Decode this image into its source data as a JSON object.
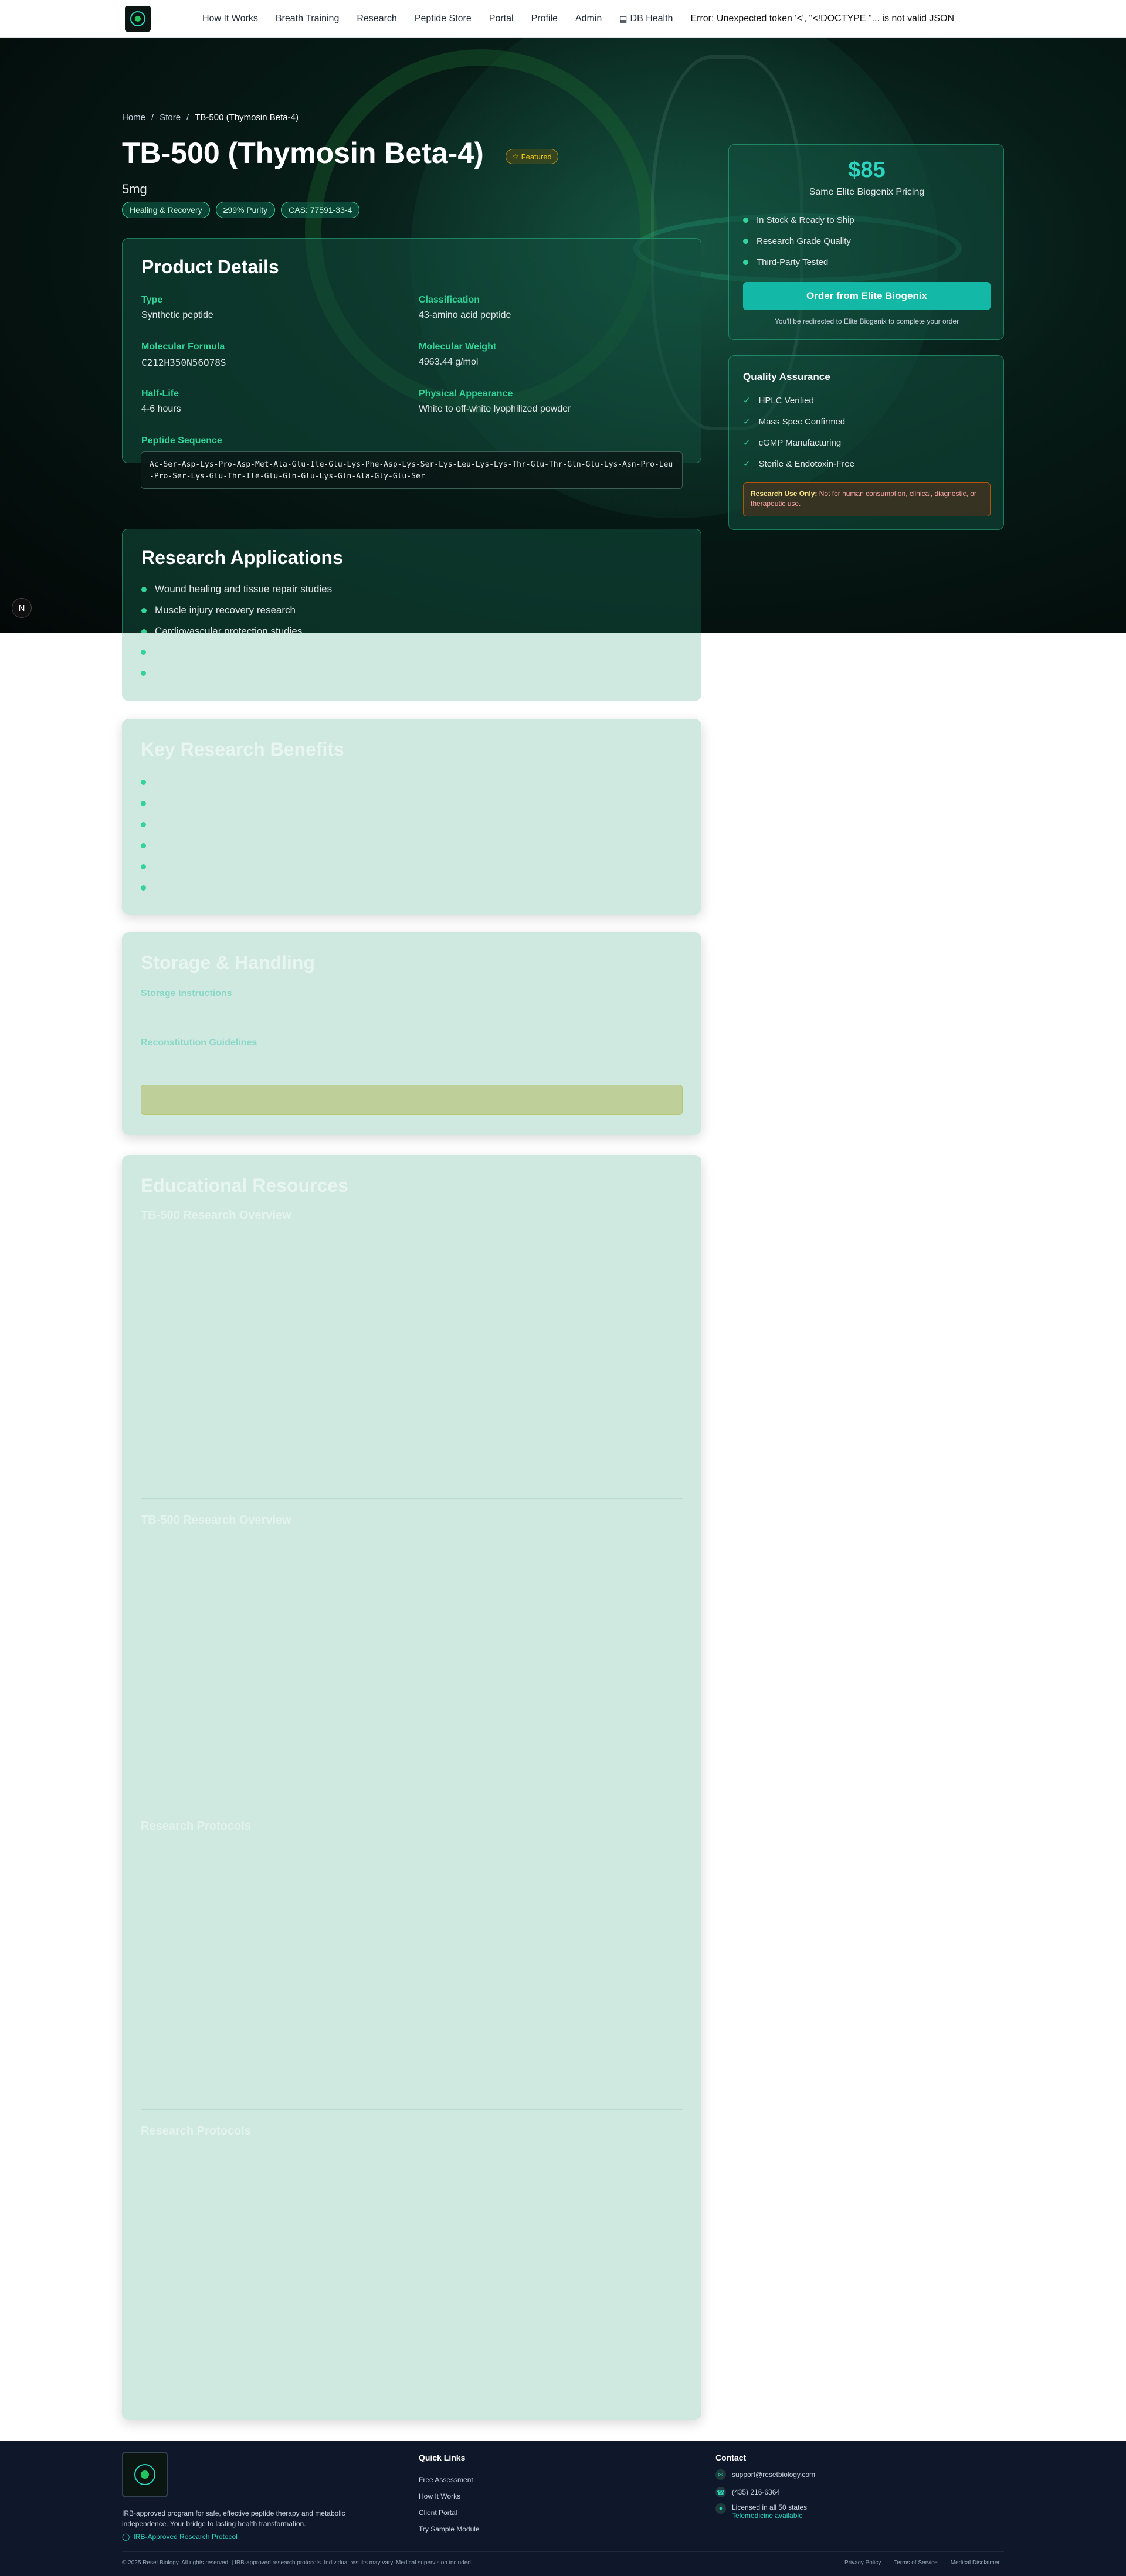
{
  "nav": {
    "links": [
      "How It Works",
      "Breath Training",
      "Research",
      "Peptide Store",
      "Portal",
      "Profile",
      "Admin",
      "DB Health"
    ],
    "db_icon": "database-icon",
    "error": "Error: Unexpected token '<', \"<!DOCTYPE \"... is not valid JSON"
  },
  "breadcrumb": [
    "Home",
    "Store",
    "TB-500 (Thymosin Beta-4)"
  ],
  "product": {
    "title": "TB-500 (Thymosin Beta-4)",
    "featured": "Featured",
    "size": "5mg",
    "tags": [
      "Healing & Recovery",
      "≥99% Purity",
      "CAS: 77591-33-4"
    ]
  },
  "details": {
    "heading": "Product Details",
    "fields": [
      {
        "label": "Type",
        "value": "Synthetic peptide"
      },
      {
        "label": "Classification",
        "value": "43-amino acid peptide"
      },
      {
        "label": "Molecular Formula",
        "value": "C212H350N56O78S"
      },
      {
        "label": "Molecular Weight",
        "value": "4963.44 g/mol"
      },
      {
        "label": "Half-Life",
        "value": "4-6 hours"
      },
      {
        "label": "Physical Appearance",
        "value": "White to off-white lyophilized powder"
      }
    ],
    "sequence_label": "Peptide Sequence",
    "sequence": "Ac-Ser-Asp-Lys-Pro-Asp-Met-Ala-Glu-Ile-Glu-Lys-Phe-Asp-Lys-Ser-Lys-Leu-Lys-Lys-Thr-Glu-Thr-Gln-Glu-Lys-Asn-Pro-Leu-Pro-Ser-Lys-Glu-Thr-Ile-Glu-Gln-Glu-Lys-Gln-Ala-Gly-Glu-Ser"
  },
  "applications": {
    "heading": "Research Applications",
    "items": [
      "Wound healing and tissue repair studies",
      "Muscle injury recovery research",
      "Cardiovascular protection studies"
    ]
  },
  "pricing": {
    "price": "$85",
    "subtitle": "Same Elite Biogenix Pricing",
    "features": [
      "In Stock & Ready to Ship",
      "Research Grade Quality",
      "Third-Party Tested"
    ],
    "button": "Order from Elite Biogenix",
    "note": "You'll be redirected to Elite Biogenix to complete your order"
  },
  "quality": {
    "heading": "Quality Assurance",
    "items": [
      "HPLC Verified",
      "Mass Spec Confirmed",
      "cGMP Manufacturing",
      "Sterile & Endotoxin-Free"
    ],
    "warning_bold": "Research Use Only:",
    "warning_text": "Not for human consumption, clinical, diagnostic, or therapeutic use."
  },
  "sections": {
    "benefits": "Key Research Benefits",
    "storage": "Storage & Handling",
    "storage_instr": "Storage Instructions",
    "recon": "Reconstitution Guidelines",
    "edu": "Educational Resources",
    "overview1": "TB-500 Research Overview",
    "overview2": "TB-500 Research Overview",
    "protocols1": "Research Protocols",
    "protocols2": "Research Protocols"
  },
  "footer": {
    "tagline": "IRB-approved program for safe, effective peptide therapy and metabolic independence. Your bridge to lasting health transformation.",
    "irb": "IRB-Approved Research Protocol",
    "quick_heading": "Quick Links",
    "quick_links": [
      "Free Assessment",
      "How It Works",
      "Client Portal",
      "Try Sample Module"
    ],
    "contact_heading": "Contact",
    "email": "support@resetbiology.com",
    "phone": "(435) 216-6364",
    "licensed": "Licensed in all 50 states",
    "telemedicine": "Telemedicine available",
    "copyright": "© 2025 Reset Biology. All rights reserved. | IRB-approved research protocols. Individual results may vary. Medical supervision included.",
    "legal": [
      "Privacy Policy",
      "Terms of Service",
      "Medical Disclaimer"
    ]
  }
}
